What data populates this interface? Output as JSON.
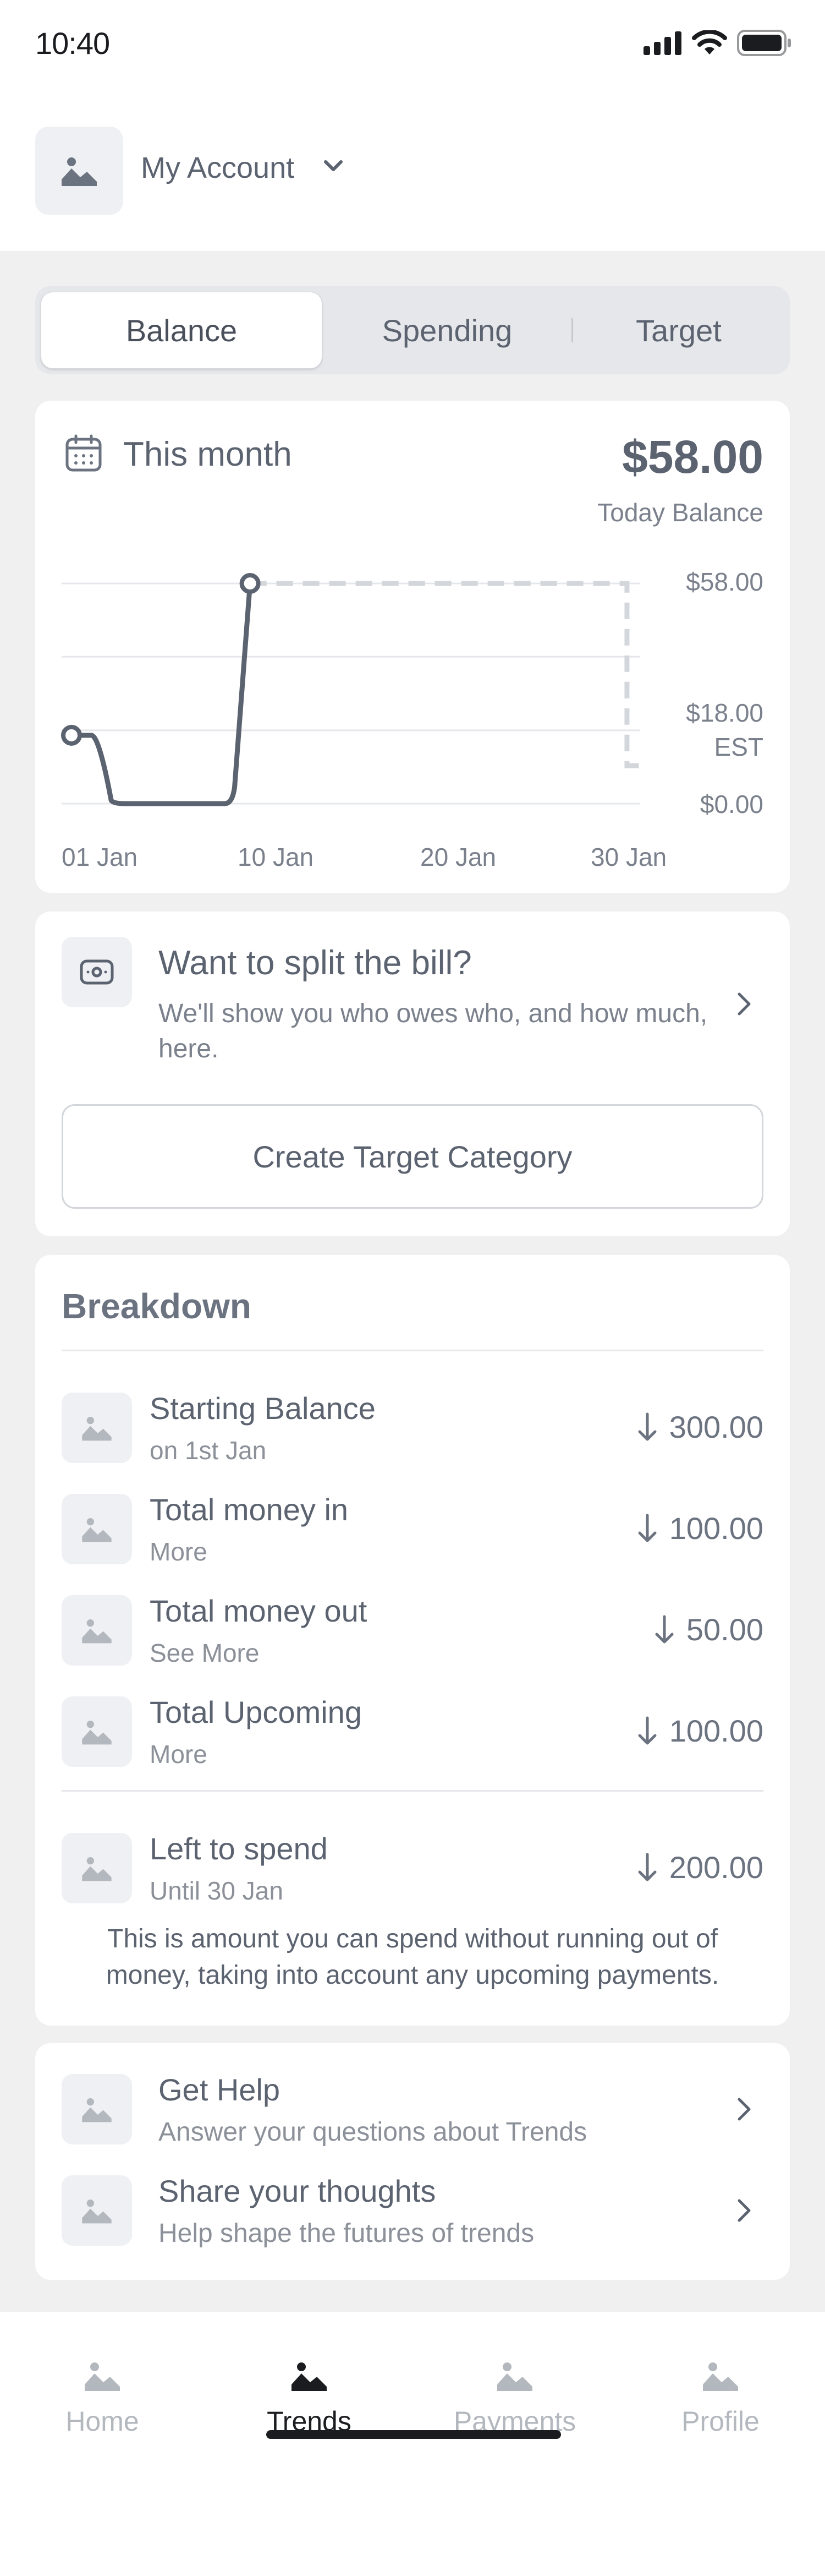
{
  "status_bar": {
    "time": "10:40",
    "icons": [
      "signal-icon",
      "wifi-icon",
      "battery-icon"
    ]
  },
  "account": {
    "title": "My Account",
    "avatar_icon": "image-icon",
    "dropdown_icon": "chevron-down-icon"
  },
  "tabs": [
    {
      "label": "Balance",
      "active": true
    },
    {
      "label": "Spending",
      "active": false
    },
    {
      "label": "Target",
      "active": false
    }
  ],
  "balance_card": {
    "period_label": "This month",
    "calendar_icon": "calendar-icon",
    "amount": "$58.00",
    "caption": "Today Balance"
  },
  "chart_data": {
    "type": "line",
    "series": [
      {
        "x": [
          "01 Jan",
          "02 Jan",
          "03 Jan",
          "09 Jan",
          "10 Jan"
        ],
        "y": [
          18,
          18,
          0,
          0,
          58
        ]
      }
    ],
    "projection": {
      "x": [
        "10 Jan",
        "29 Jan",
        "29 Jan",
        "30 Jan"
      ],
      "y": [
        58,
        58,
        10,
        10
      ],
      "style": "dashed"
    },
    "x_tick_labels": [
      "01 Jan",
      "10 Jan",
      "20 Jan",
      "30 Jan"
    ],
    "y_tick_labels": [
      "$58.00",
      "$18.00",
      "EST",
      "$0.00"
    ],
    "ylim": [
      0,
      58
    ],
    "grid": true
  },
  "split": {
    "icon": "wallet-icon",
    "title": "Want to split the bill?",
    "description": "We'll show you who owes who, and how much, here.",
    "chevron_icon": "chevron-right-icon",
    "button_label": "Create Target Category"
  },
  "breakdown": {
    "title": "Breakdown",
    "rows": [
      {
        "title": "Starting Balance",
        "subtitle": "on 1st Jan",
        "amount": "300.00",
        "icon": "image-icon",
        "arrow_icon": "arrow-down-icon"
      },
      {
        "title": "Total money in",
        "subtitle": "More",
        "amount": "100.00",
        "icon": "image-icon",
        "arrow_icon": "arrow-down-icon"
      },
      {
        "title": "Total money out",
        "subtitle": "See More",
        "amount": "50.00",
        "icon": "image-icon",
        "arrow_icon": "arrow-down-icon"
      },
      {
        "title": "Total Upcoming",
        "subtitle": "More",
        "amount": "100.00",
        "icon": "image-icon",
        "arrow_icon": "arrow-down-icon"
      }
    ],
    "left_to_spend": {
      "title": "Left to spend",
      "subtitle": "Until 30 Jan",
      "amount": "200.00",
      "icon": "image-icon",
      "arrow_icon": "arrow-down-icon"
    },
    "note": "This is amount you can spend without running out of money, taking into account any upcoming payments."
  },
  "help": [
    {
      "title": "Get Help",
      "subtitle": "Answer your questions about Trends",
      "icon": "image-icon"
    },
    {
      "title": "Share your thoughts",
      "subtitle": "Help shape the futures of trends",
      "icon": "image-icon"
    }
  ],
  "tab_bar": [
    {
      "label": "Home",
      "active": false,
      "icon": "image-icon"
    },
    {
      "label": "Trends",
      "active": true,
      "icon": "image-icon"
    },
    {
      "label": "Payments",
      "active": false,
      "icon": "image-icon"
    },
    {
      "label": "Profile",
      "active": false,
      "icon": "image-icon"
    }
  ],
  "colors": {
    "background": "#f0f0f1",
    "card": "#ffffff",
    "text": "#5c6370",
    "muted": "#8b9099",
    "line": "#5c6370",
    "dashed": "#d3d6db",
    "active_tab": "#1b1c1f"
  }
}
